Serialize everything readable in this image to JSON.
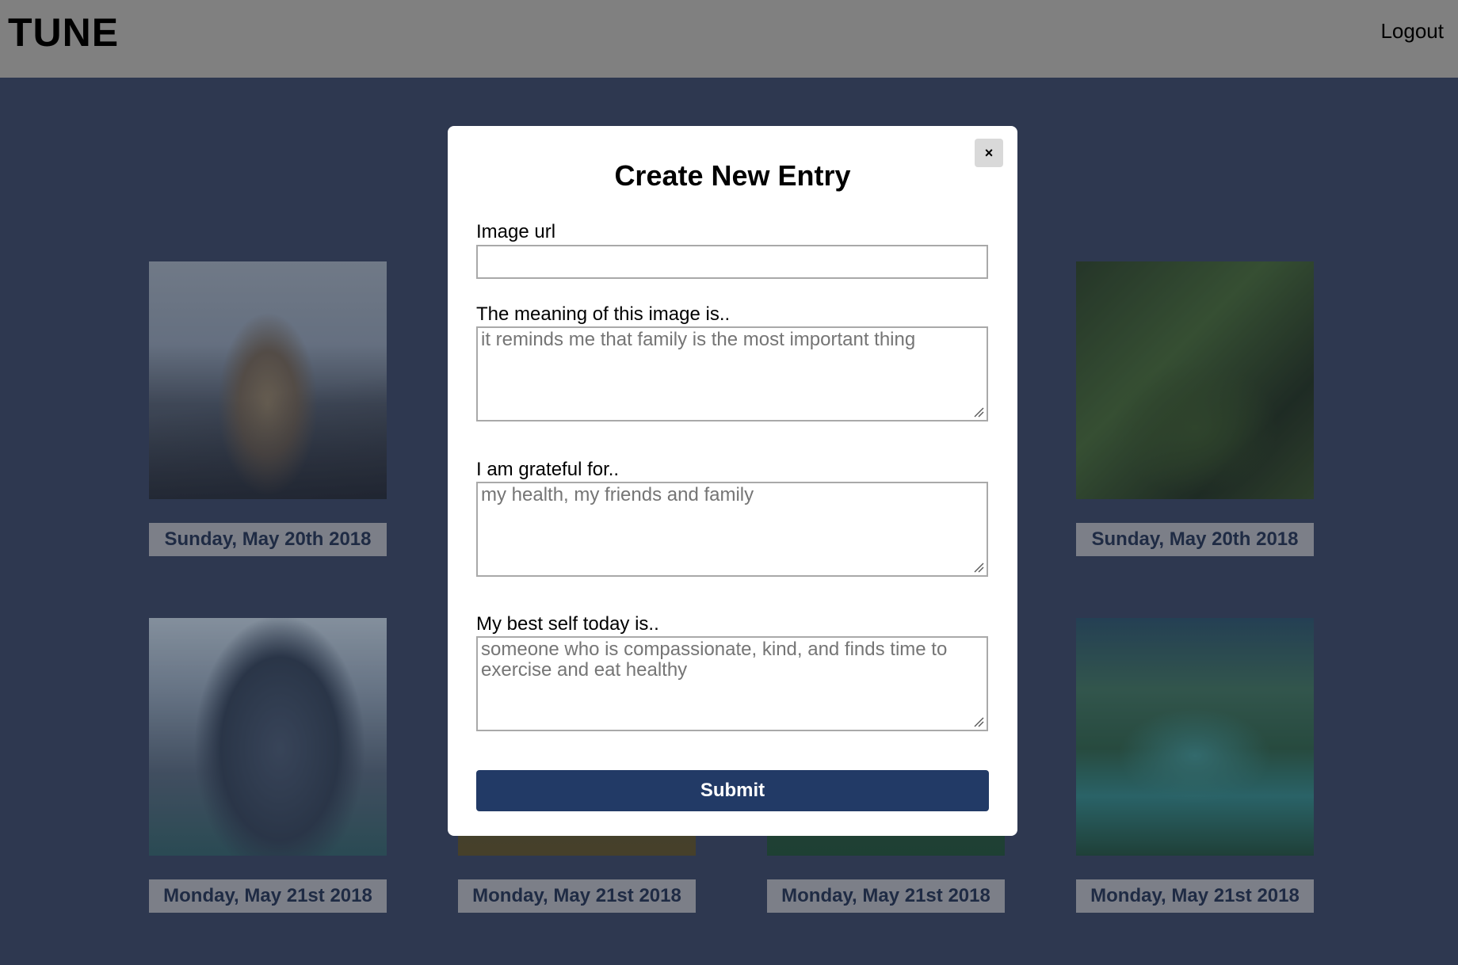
{
  "header": {
    "brand": "TUNE",
    "logout_label": "Logout"
  },
  "cards": [
    {
      "date": "Sunday, May 20th 2018",
      "image": "mountain-cliff-photo"
    },
    {
      "date": "Sunday, May 20th 2018",
      "image": "mossy-forest-photo"
    },
    {
      "date": "Monday, May 21st 2018",
      "image": "snowy-peak-photo"
    },
    {
      "date": "Monday, May 21st 2018",
      "image": "hidden-photo"
    },
    {
      "date": "Monday, May 21st 2018",
      "image": "hidden-photo"
    },
    {
      "date": "Monday, May 21st 2018",
      "image": "tropical-lagoon-photo"
    }
  ],
  "modal": {
    "title": "Create New Entry",
    "close_label": "×",
    "image_url_label": "Image url",
    "image_url_value": "",
    "meaning_label": "The meaning of this image is..",
    "meaning_placeholder": "it reminds me that family is the most important thing",
    "grateful_label": "I am grateful for..",
    "grateful_placeholder": "my health, my friends and family",
    "best_self_label": "My best self today is..",
    "best_self_placeholder": "someone who is compassionate, kind, and finds time to exercise and eat healthy",
    "submit_label": "Submit"
  },
  "colors": {
    "page_bg": "#2e3850",
    "header_bg": "#808080",
    "submit_bg": "#223a66",
    "date_bg": "#7c7f88",
    "date_text": "#1f2b44"
  }
}
